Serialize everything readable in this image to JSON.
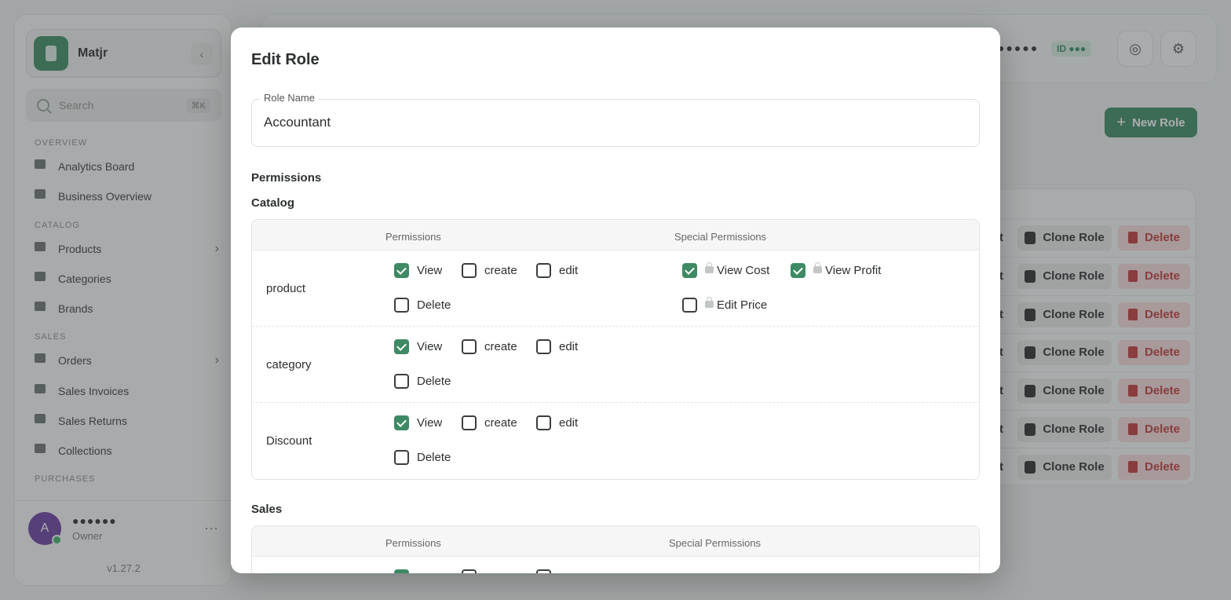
{
  "app": {
    "name": "Matjr",
    "version": "v1.27.2"
  },
  "search": {
    "placeholder": "Search",
    "shortcut": "⌘K"
  },
  "sidebar": {
    "sections": [
      {
        "title": "OVERVIEW"
      },
      {
        "title": "CATALOG"
      },
      {
        "title": "SALES"
      },
      {
        "title": "PURCHASES"
      }
    ],
    "items": [
      {
        "label": "Analytics Board",
        "icon": "gauge-icon"
      },
      {
        "label": "Business Overview",
        "icon": "grid-icon"
      },
      {
        "label": "Products",
        "icon": "box-icon"
      },
      {
        "label": "Categories",
        "icon": "shapes-icon"
      },
      {
        "label": "Brands",
        "icon": "tag-icon"
      },
      {
        "label": "Orders",
        "icon": "cart-icon"
      },
      {
        "label": "Sales Invoices",
        "icon": "invoice-icon"
      },
      {
        "label": "Sales Returns",
        "icon": "return-icon"
      },
      {
        "label": "Collections",
        "icon": "collection-icon"
      }
    ]
  },
  "user": {
    "name": "●●●●●●",
    "role": "Owner",
    "initial": "A"
  },
  "topbar": {
    "masked": "●●●●●",
    "id_badge": "ID ●●●"
  },
  "main": {
    "new_role_label": "New Role",
    "row_fragment": "t",
    "clone_label": "Clone Role",
    "delete_label": "Delete"
  },
  "modal": {
    "title": "Edit Role",
    "role_name_label": "Role Name",
    "role_name_value": "Accountant",
    "permissions_heading": "Permissions",
    "groups": [
      {
        "title": "Catalog",
        "col_permissions": "Permissions",
        "col_special": "Special Permissions",
        "rows": [
          {
            "name": "product",
            "view": "View",
            "create": "create",
            "edit": "edit",
            "delete": "Delete",
            "special": [
              {
                "label": "View Cost"
              },
              {
                "label": "View Profit"
              },
              {
                "label": "Edit Price"
              }
            ]
          },
          {
            "name": "category",
            "view": "View",
            "create": "create",
            "edit": "edit",
            "delete": "Delete"
          },
          {
            "name": "Discount",
            "view": "View",
            "create": "create",
            "edit": "edit",
            "delete": "Delete"
          }
        ]
      },
      {
        "title": "Sales",
        "col_permissions": "Permissions",
        "col_special": "Special Permissions"
      }
    ]
  },
  "colors": {
    "accent": "#3d8a64",
    "danger": "#c23b3b"
  }
}
